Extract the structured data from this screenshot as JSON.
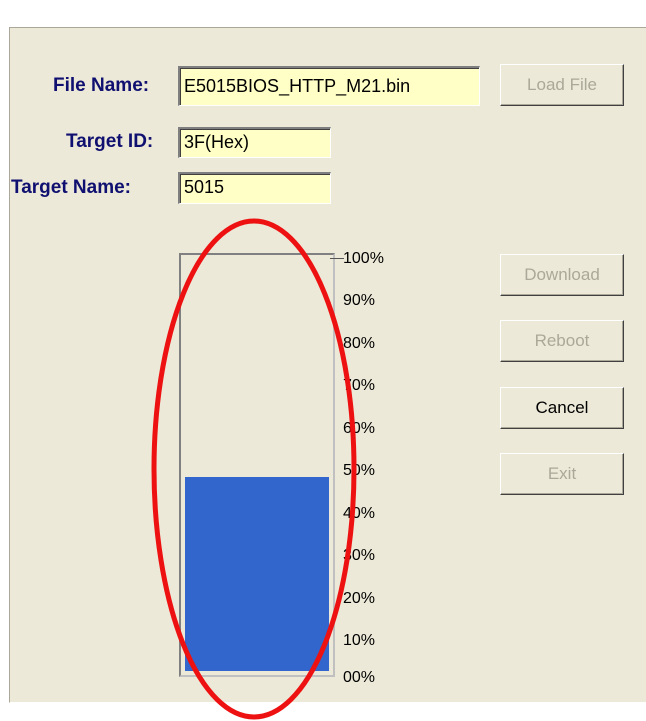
{
  "form": {
    "file_name_label": "File Name:",
    "file_name_value": "E5015BIOS_HTTP_M21.bin",
    "target_id_label": "Target ID:",
    "target_id_value": "3F(Hex)",
    "target_name_label": "Target Name:",
    "target_name_value": "5015"
  },
  "buttons": {
    "load_file": "Load File",
    "download": "Download",
    "reboot": "Reboot",
    "cancel": "Cancel",
    "exit": "Exit"
  },
  "progress": {
    "percent": 47,
    "scale": [
      "100%",
      "90%",
      "80%",
      "70%",
      "60%",
      "50%",
      "40%",
      "30%",
      "20%",
      "10%",
      "00%"
    ]
  },
  "colors": {
    "progress_fill": "#3366cc",
    "annotation": "#ee1111",
    "field_bg": "#ffffc6",
    "label": "#101070"
  }
}
